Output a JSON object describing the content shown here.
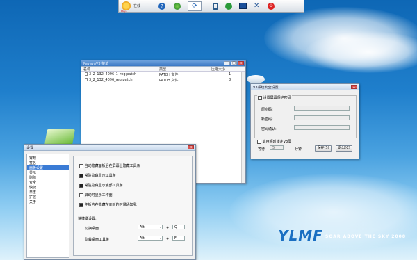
{
  "toolbar": {
    "avatar_text": "Ptaya",
    "app_label": "在线",
    "icons": [
      "help-icon",
      "globe-icon",
      "refresh-icon",
      "lock-icon",
      "download-icon",
      "monitor-icon",
      "tools-icon",
      "power-icon"
    ]
  },
  "file_window": {
    "title": "PayayaV3 菜单",
    "columns": [
      "名称",
      "类型",
      "压缩大小"
    ],
    "rows": [
      {
        "name": "3_2_132_4096_1_reg.patch",
        "type": "PATCH 文件",
        "size": "1"
      },
      {
        "name": "3_2_132_4096_reg.patch",
        "type": "PATCH 文件",
        "size": "8"
      }
    ]
  },
  "password_dialog": {
    "title": "V3系统安全设置",
    "enable_label": "设置屏幕保护密码",
    "field_labels": [
      "原密码:",
      "新密码:",
      "密码确认:"
    ],
    "timeout_label": "启用超时锁定V3屏",
    "wait_label": "等待",
    "wait_value": "5",
    "minutes_label": "分钟",
    "ok_label": "保存(S)",
    "cancel_label": "退出(C)"
  },
  "settings_window": {
    "title": "设置",
    "nav_items": [
      "常规",
      "签名",
      "面板设置",
      "显示",
      "删除",
      "安全",
      "快捷",
      "日志",
      "扩展",
      "关于"
    ],
    "selected_index": 2,
    "options": [
      {
        "label": "自动隐藏面板后在屏幕上隐藏工具条",
        "checked": false
      },
      {
        "label": "常驻隐藏显示工具条",
        "checked": true
      },
      {
        "label": "常驻隐藏显示底部工具条",
        "checked": true
      },
      {
        "label": "启动时显示工作面",
        "checked": false
      },
      {
        "label": "主板内存隐藏在面板的时候通知我",
        "checked": true
      }
    ],
    "hotkey_header": "快捷键设置:",
    "hotkeys": [
      {
        "label": "切换桌面",
        "mod": "Alt",
        "key": "Q"
      },
      {
        "label": "隐藏桌面工具条",
        "mod": "Alt",
        "key": "F"
      }
    ]
  },
  "brand": {
    "logo_text": "YLMF",
    "slogan": "SOAR ABOVE THE SKY 2008"
  }
}
